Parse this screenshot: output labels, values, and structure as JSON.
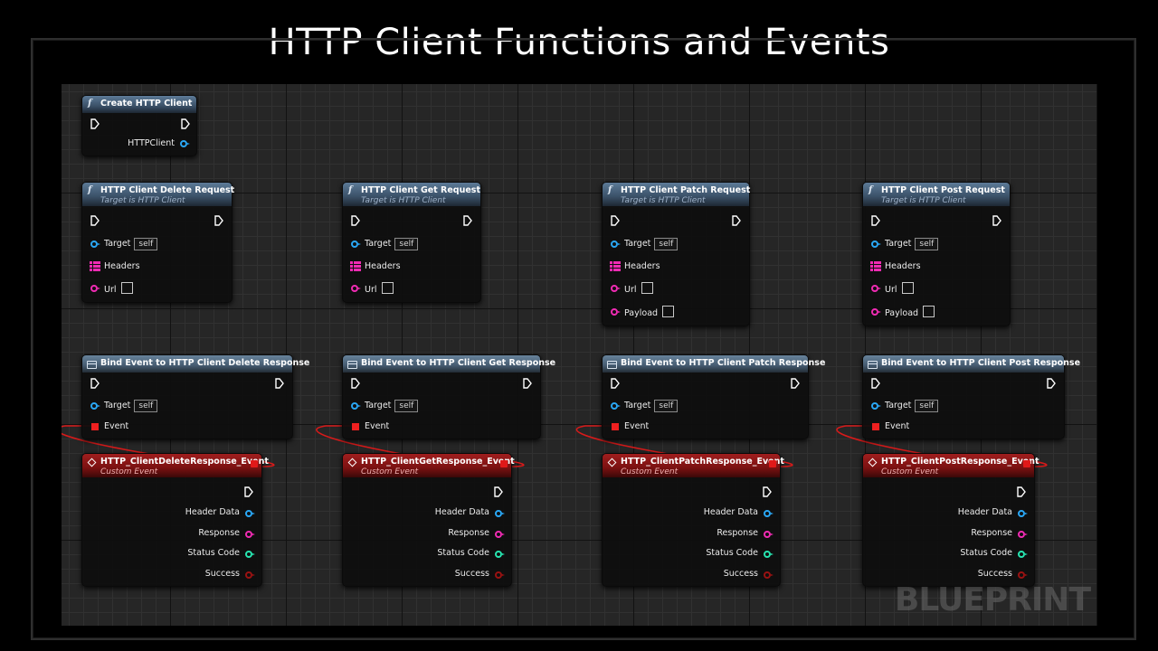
{
  "title": "HTTP Client Functions and Events",
  "watermark": "BLUEPRINT",
  "create_node": {
    "title": "Create HTTP Client",
    "output": "HTTPClient"
  },
  "request_nodes": [
    {
      "title": "HTTP Client Delete Request",
      "subtitle": "Target is HTTP Client",
      "target": "Target",
      "target_default": "self",
      "headers": "Headers",
      "url": "Url",
      "payload": null
    },
    {
      "title": "HTTP Client Get Request",
      "subtitle": "Target is HTTP Client",
      "target": "Target",
      "target_default": "self",
      "headers": "Headers",
      "url": "Url",
      "payload": null
    },
    {
      "title": "HTTP Client Patch Request",
      "subtitle": "Target is HTTP Client",
      "target": "Target",
      "target_default": "self",
      "headers": "Headers",
      "url": "Url",
      "payload": "Payload"
    },
    {
      "title": "HTTP Client Post Request",
      "subtitle": "Target is HTTP Client",
      "target": "Target",
      "target_default": "self",
      "headers": "Headers",
      "url": "Url",
      "payload": "Payload"
    }
  ],
  "bind_nodes": [
    {
      "title": "Bind Event to HTTP Client Delete Response",
      "target": "Target",
      "target_default": "self",
      "event": "Event"
    },
    {
      "title": "Bind Event to HTTP Client Get Response",
      "target": "Target",
      "target_default": "self",
      "event": "Event"
    },
    {
      "title": "Bind Event to HTTP Client Patch Response",
      "target": "Target",
      "target_default": "self",
      "event": "Event"
    },
    {
      "title": "Bind Event to HTTP Client Post Response",
      "target": "Target",
      "target_default": "self",
      "event": "Event"
    }
  ],
  "event_nodes": [
    {
      "title": "HTTP_ClientDeleteResponse_Event",
      "subtitle": "Custom Event",
      "outputs": [
        "Header Data",
        "Response",
        "Status Code",
        "Success"
      ]
    },
    {
      "title": "HTTP_ClientGetResponse_Event",
      "subtitle": "Custom Event",
      "outputs": [
        "Header Data",
        "Response",
        "Status Code",
        "Success"
      ]
    },
    {
      "title": "HTTP_ClientPatchResponse_Event",
      "subtitle": "Custom Event",
      "outputs": [
        "Header Data",
        "Response",
        "Status Code",
        "Success"
      ]
    },
    {
      "title": "HTTP_ClientPostResponse_Event",
      "subtitle": "Custom Event",
      "outputs": [
        "Header Data",
        "Response",
        "Status Code",
        "Success"
      ]
    }
  ],
  "colors": {
    "object_pin": "#2aa7f5",
    "string_pin": "#f02bb3",
    "int_pin": "#27e5b0",
    "bool_pin": "#9a1212",
    "delegate_pin": "#ee2020",
    "event_header": "#a01e1e",
    "function_header": "#4c6682"
  }
}
